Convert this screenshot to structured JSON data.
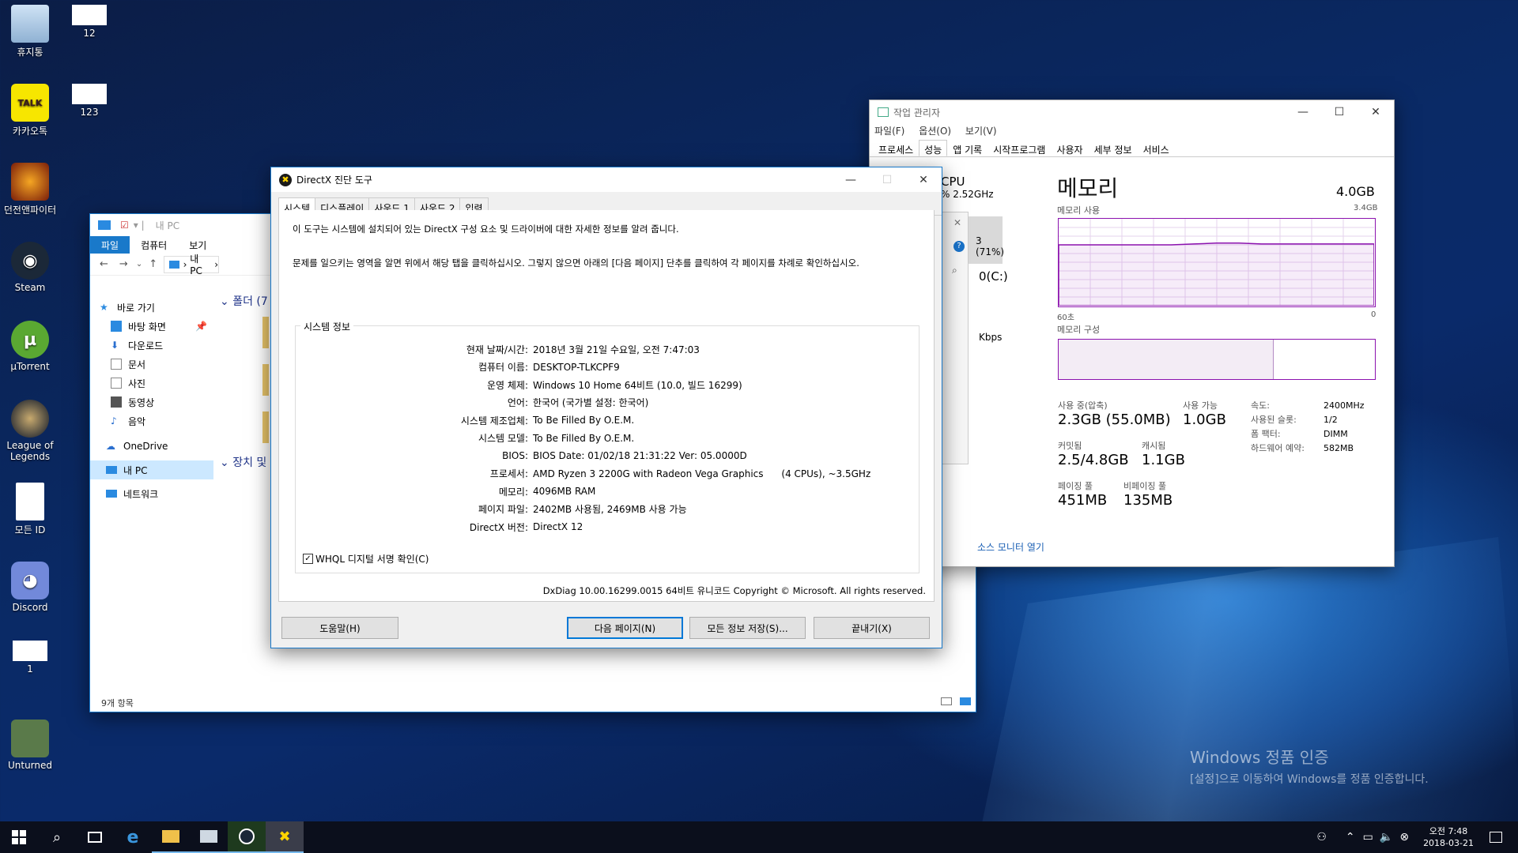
{
  "desktop": {
    "icons": [
      {
        "label": "휴지통",
        "icon": "recycle-bin-icon"
      },
      {
        "label": "12",
        "icon": "file-icon"
      },
      {
        "label": "카카오톡",
        "icon": "kakaotalk-icon",
        "badge": "TALK"
      },
      {
        "label": "123",
        "icon": "file-icon"
      },
      {
        "label": "던전앤파이터",
        "icon": "dnf-icon"
      },
      {
        "label": "Steam",
        "icon": "steam-icon"
      },
      {
        "label": "µTorrent",
        "icon": "utorrent-icon"
      },
      {
        "label": "League of Legends",
        "icon": "league-icon"
      },
      {
        "label": "모든 ID",
        "icon": "text-file-icon"
      },
      {
        "label": "Discord",
        "icon": "discord-icon"
      },
      {
        "label": "1",
        "icon": "file-icon"
      },
      {
        "label": "Unturned",
        "icon": "unturned-icon"
      }
    ],
    "watermark": {
      "title": "Windows 정품 인증",
      "subtitle": "[설정]으로 이동하여 Windows를 정품 인증합니다."
    }
  },
  "explorer": {
    "title": "내 PC",
    "ribbon": [
      "파일",
      "컴퓨터",
      "보기"
    ],
    "address": "내 PC",
    "nav": [
      "바로 가기",
      "바탕 화면",
      "다운로드",
      "문서",
      "사진",
      "동영상",
      "음악",
      "OneDrive",
      "내 PC",
      "네트워크"
    ],
    "sections": [
      "폴더 (7",
      "장치 및"
    ],
    "status": "9개 항목"
  },
  "taskmgr": {
    "title": "작업 관리자",
    "menu": [
      "파일(F)",
      "옵션(O)",
      "보기(V)"
    ],
    "tabs": [
      "프로세스",
      "성능",
      "앱 기록",
      "시작프로그램",
      "사용자",
      "세부 정보",
      "서비스"
    ],
    "cpu_label": "CPU",
    "cpu_detail": "% 2.52GHz",
    "mem_percent": "3 (71%)",
    "disk_label": "0(C:)",
    "kbps": "Kbps",
    "heading": "메모리",
    "total": "4.0GB",
    "usage_label": "메모리 사용",
    "usage_max": "3.4GB",
    "axis_left": "60초",
    "axis_right": "0",
    "composition_label": "메모리 구성",
    "in_use_fraction": 0.68,
    "stats": [
      {
        "label": "사용 중(압축)",
        "value": "2.3GB (55.0MB)"
      },
      {
        "label": "사용 가능",
        "value": "1.0GB"
      },
      {
        "label": "커밋됨",
        "value": "2.5/4.8GB"
      },
      {
        "label": "캐시됨",
        "value": "1.1GB"
      },
      {
        "label": "페이징 풀",
        "value": "451MB"
      },
      {
        "label": "비페이징 풀",
        "value": "135MB"
      }
    ],
    "specs": [
      {
        "k": "속도:",
        "v": "2400MHz"
      },
      {
        "k": "사용된 슬롯:",
        "v": "1/2"
      },
      {
        "k": "폼 팩터:",
        "v": "DIMM"
      },
      {
        "k": "하드웨어 예약:",
        "v": "582MB"
      }
    ],
    "resmon": "소스 모니터 열기"
  },
  "dxdiag": {
    "title": "DirectX 진단 도구",
    "tabs": [
      "시스템",
      "디스플레이",
      "사운드 1",
      "사운드 2",
      "입력"
    ],
    "intro1": "이 도구는 시스템에 설치되어 있는 DirectX 구성 요소 및 드라이버에 대한 자세한 정보를 알려 줍니다.",
    "intro2": "문제를 일으키는 영역을 알면 위에서 해당 탭을 클릭하십시오. 그렇지 않으면 아래의 [다음 페이지] 단추를 클릭하여 각 페이지를 차례로 확인하십시오.",
    "group": "시스템 정보",
    "rows": [
      {
        "k": "현재 날짜/시간:",
        "v": "2018년 3월 21일 수요일, 오전 7:47:03"
      },
      {
        "k": "컴퓨터 이름:",
        "v": "DESKTOP-TLKCPF9"
      },
      {
        "k": "운영 체제:",
        "v": "Windows 10 Home 64비트 (10.0, 빌드 16299)"
      },
      {
        "k": "언어:",
        "v": "한국어 (국가별 설정: 한국어)"
      },
      {
        "k": "시스템 제조업체:",
        "v": "To Be Filled By O.E.M."
      },
      {
        "k": "시스템 모델:",
        "v": "To Be Filled By O.E.M."
      },
      {
        "k": "BIOS:",
        "v": "BIOS Date: 01/02/18 21:31:22 Ver: 05.0000D"
      },
      {
        "k": "프로세서:",
        "v": "AMD Ryzen 3 2200G with Radeon Vega Graphics      (4 CPUs), ~3.5GHz"
      },
      {
        "k": "메모리:",
        "v": "4096MB RAM"
      },
      {
        "k": "페이지 파일:",
        "v": "2402MB 사용됨, 2469MB 사용 가능"
      },
      {
        "k": "DirectX 버전:",
        "v": "DirectX 12"
      }
    ],
    "whql": "WHQL 디지털 서명 확인(C)",
    "footer": "DxDiag 10.00.16299.0015 64비트 유니코드  Copyright © Microsoft. All rights reserved.",
    "buttons": {
      "help": "도움말(H)",
      "next": "다음 페이지(N)",
      "save": "모든 정보 저장(S)...",
      "exit": "끝내기(X)"
    }
  },
  "taskbar": {
    "time": "오전 7:48",
    "date": "2018-03-21"
  }
}
